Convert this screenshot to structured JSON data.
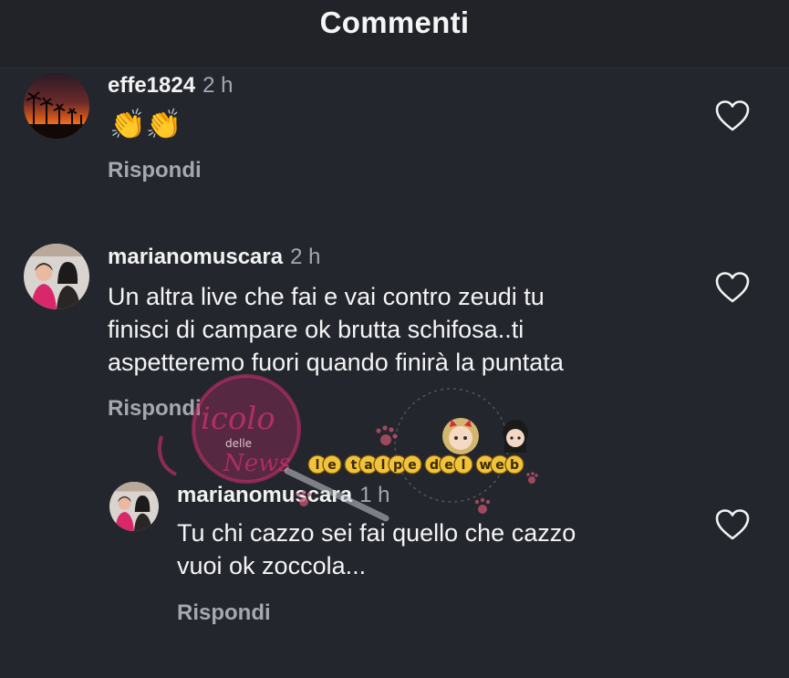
{
  "header": {
    "title": "Commenti"
  },
  "comments": [
    {
      "username": "effe1824",
      "time": "2 h",
      "text_lines": [
        "👏👏"
      ],
      "reply_label": "Rispondi",
      "like_icon": "heart-outline-icon"
    },
    {
      "username": "marianomuscara",
      "time": "2 h",
      "text_lines": [
        "Un altra live che fai e vai contro zeudi tu",
        "finisci di campare ok brutta schifosa..ti",
        "aspetteremo fuori quando finirà la puntata"
      ],
      "reply_label": "Rispondi",
      "like_icon": "heart-outline-icon"
    },
    {
      "username": "marianomuscara",
      "time": "1 h",
      "text_lines": [
        "Tu chi cazzo sei fai quello che cazzo",
        "vuoi ok zoccola..."
      ],
      "reply_label": "Rispondi",
      "like_icon": "heart-outline-icon"
    }
  ],
  "watermark": {
    "brand_1": "Vicolo delle News",
    "brand_2": "le talpe del web"
  },
  "colors": {
    "background": "#23262d",
    "text": "#f2f2f2",
    "secondary_text": "#a5a8ae",
    "watermark_pink": "#d0306f"
  }
}
